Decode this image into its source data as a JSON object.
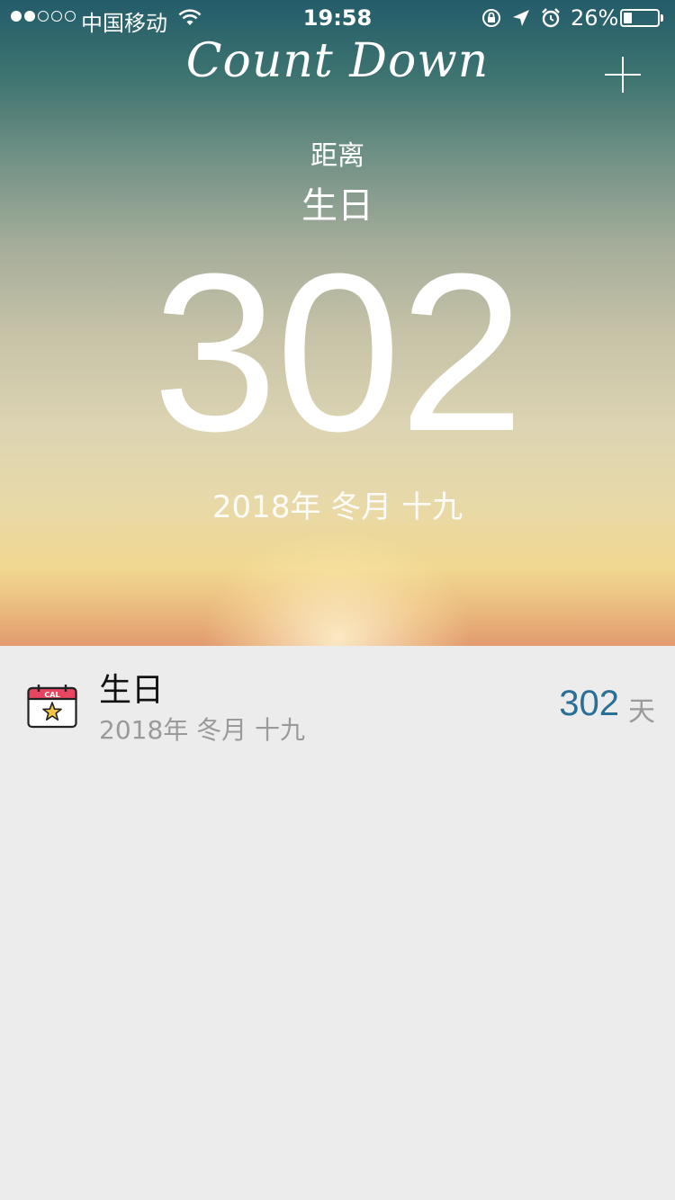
{
  "status_bar": {
    "carrier": "中国移动",
    "time": "19:58",
    "battery_percent": "26%",
    "battery_level": 0.26,
    "signal_bars": 2,
    "signal_total": 5
  },
  "header": {
    "title": "Count Down",
    "add_icon": "plus-icon"
  },
  "hero": {
    "prefix": "距离",
    "event_name": "生日",
    "days": "302",
    "date": "2018年 冬月 十九"
  },
  "events": [
    {
      "icon": "calendar-star-icon",
      "icon_label": "CAL",
      "title": "生日",
      "date": "2018年 冬月 十九",
      "days": "302",
      "unit": "天"
    }
  ],
  "colors": {
    "accent": "#2a6f96",
    "calendar_header": "#e94560",
    "background": "#ececec"
  }
}
